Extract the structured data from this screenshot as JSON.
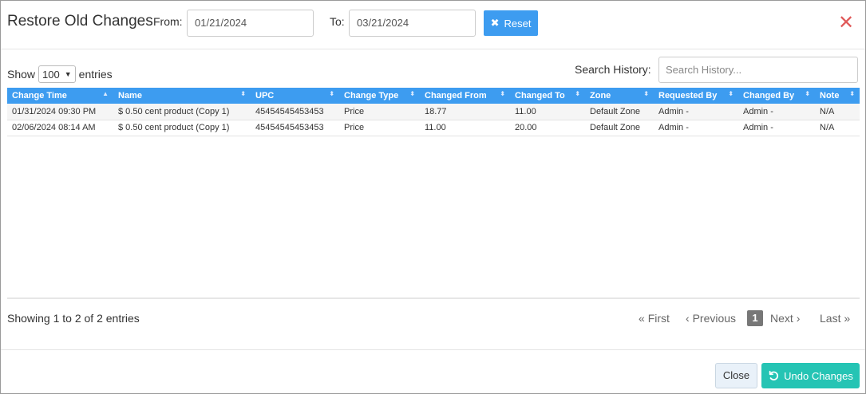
{
  "header": {
    "title": "Restore Old Changes",
    "from_label": "From:",
    "from_value": "01/21/2024",
    "to_label": "To:",
    "to_value": "03/21/2024",
    "reset_label": "Reset",
    "close_icon": "close-icon"
  },
  "controls": {
    "show_label": "Show",
    "show_value": "100",
    "entries_label": "entries",
    "search_label": "Search History:",
    "search_placeholder": "Search History..."
  },
  "table": {
    "columns": [
      "Change Time",
      "Name",
      "UPC",
      "Change Type",
      "Changed From",
      "Changed To",
      "Zone",
      "Requested By",
      "Changed By",
      "Note"
    ],
    "sorted_column": "Change Time",
    "rows": [
      [
        "01/31/2024 09:30 PM",
        "$ 0.50 cent product (Copy 1)",
        "45454545453453",
        "Price",
        "18.77",
        "11.00",
        "Default Zone",
        "Admin -",
        "Admin -",
        "N/A"
      ],
      [
        "02/06/2024 08:14 AM",
        "$ 0.50 cent product (Copy 1)",
        "45454545453453",
        "Price",
        "11.00",
        "20.00",
        "Default Zone",
        "Admin -",
        "Admin -",
        "N/A"
      ]
    ]
  },
  "pagination": {
    "info": "Showing 1 to 2 of 2 entries",
    "first": "First",
    "previous": "Previous",
    "current_page": "1",
    "next": "Next",
    "last": "Last"
  },
  "footer": {
    "close_label": "Close",
    "undo_label": "Undo Changes"
  },
  "colors": {
    "header_blue": "#3d9cf0",
    "undo_teal": "#25c4b4",
    "close_red": "#e05a5a"
  }
}
